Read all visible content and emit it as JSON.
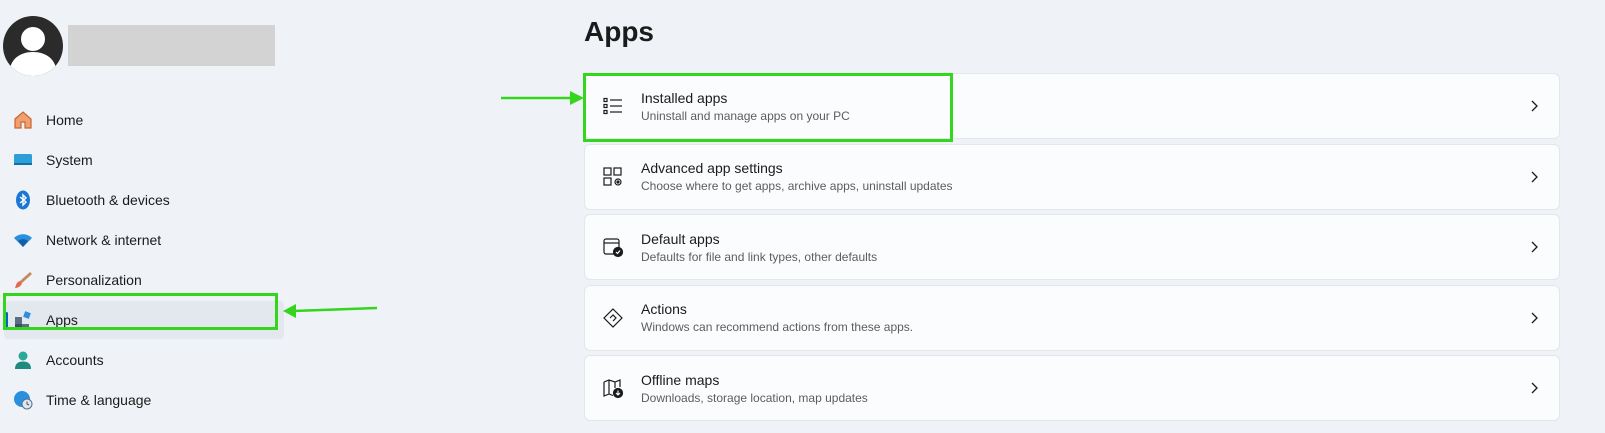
{
  "user": {
    "avatar_icon": "person-icon"
  },
  "sidebar": {
    "items": [
      {
        "label": "Home",
        "icon": "home-icon"
      },
      {
        "label": "System",
        "icon": "monitor-icon"
      },
      {
        "label": "Bluetooth & devices",
        "icon": "bluetooth-icon"
      },
      {
        "label": "Network & internet",
        "icon": "wifi-icon"
      },
      {
        "label": "Personalization",
        "icon": "brush-icon"
      },
      {
        "label": "Apps",
        "icon": "apps-icon",
        "selected": true
      },
      {
        "label": "Accounts",
        "icon": "account-icon"
      },
      {
        "label": "Time & language",
        "icon": "globe-clock-icon"
      }
    ]
  },
  "main": {
    "title": "Apps",
    "cards": [
      {
        "title": "Installed apps",
        "desc": "Uninstall and manage apps on your PC",
        "icon": "list-icon"
      },
      {
        "title": "Advanced app settings",
        "desc": "Choose where to get apps, archive apps, uninstall updates",
        "icon": "apps-gear-icon"
      },
      {
        "title": "Default apps",
        "desc": "Defaults for file and link types, other defaults",
        "icon": "default-apps-icon"
      },
      {
        "title": "Actions",
        "desc": "Windows can recommend actions from these apps.",
        "icon": "actions-icon"
      },
      {
        "title": "Offline maps",
        "desc": "Downloads, storage location, map updates",
        "icon": "map-download-icon"
      }
    ]
  },
  "colors": {
    "accent": "#0067c0",
    "highlight": "#33d61c",
    "background": "#eff3f8"
  }
}
